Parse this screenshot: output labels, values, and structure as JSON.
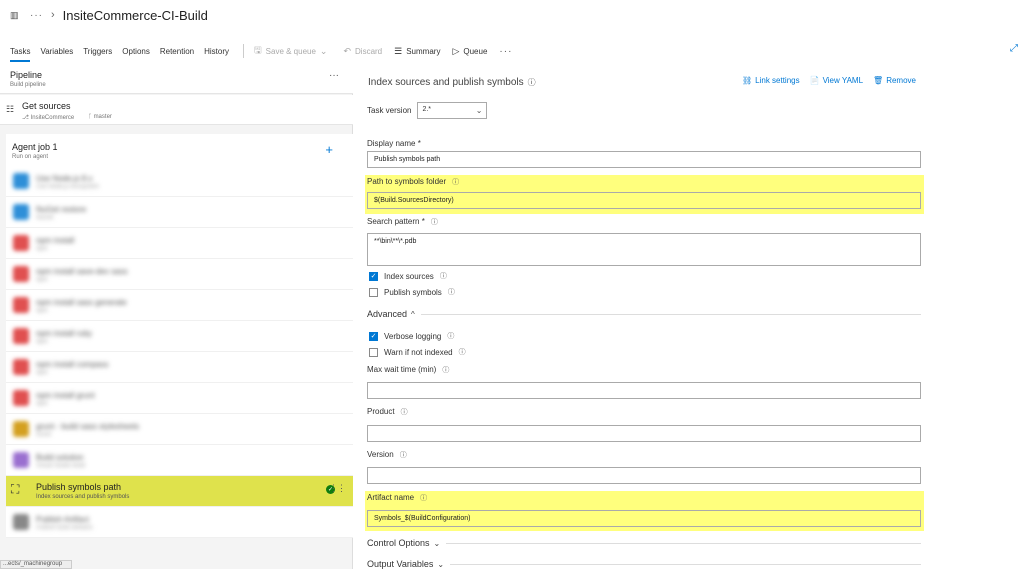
{
  "header": {
    "title": "InsiteCommerce-CI-Build",
    "dots": "···",
    "chevron": "›"
  },
  "tabs": [
    {
      "label": "Tasks",
      "active": true
    },
    {
      "label": "Variables"
    },
    {
      "label": "Triggers"
    },
    {
      "label": "Options"
    },
    {
      "label": "Retention"
    },
    {
      "label": "History"
    }
  ],
  "toolbar": {
    "save_queue": "Save & queue",
    "discard": "Discard",
    "summary": "Summary",
    "queue": "Queue",
    "more": "···"
  },
  "pipeline": {
    "title": "Pipeline",
    "subtitle": "Build pipeline",
    "more": "···"
  },
  "get_sources": {
    "title": "Get sources",
    "repo": "InsiteCommerce",
    "branch": "master"
  },
  "agent_job": {
    "title": "Agent job 1",
    "subtitle": "Run on agent",
    "add": "+"
  },
  "tasks": [
    {
      "title": "Use Node.js 8.x",
      "sub": "Use Node.js ecosystem",
      "color": "#2e8fd8"
    },
    {
      "title": "NuGet restore",
      "sub": "NuGet",
      "color": "#2e8fd8"
    },
    {
      "title": "npm install",
      "sub": "npm",
      "color": "#e05050"
    },
    {
      "title": "npm install save-dev sass",
      "sub": "npm",
      "color": "#e05050"
    },
    {
      "title": "npm install sass generate",
      "sub": "npm",
      "color": "#e05050"
    },
    {
      "title": "npm install ruby",
      "sub": "npm",
      "color": "#e05050"
    },
    {
      "title": "npm install compass",
      "sub": "npm",
      "color": "#e05050"
    },
    {
      "title": "npm install grunt",
      "sub": "npm",
      "color": "#e05050"
    },
    {
      "title": "grunt - build sass stylesheets",
      "sub": "Grunt",
      "color": "#d4a020"
    },
    {
      "title": "Build solution",
      "sub": "Visual Studio build",
      "color": "#9a6fd0"
    }
  ],
  "selected_task": {
    "title": "Publish symbols path",
    "subtitle": "Index sources and publish symbols",
    "status": "✓",
    "grip": "⋮⋮"
  },
  "last_task": {
    "title": "Publish Artifact",
    "sub": "Publish build artifacts"
  },
  "statusbar": "...ects/_machinegroup",
  "panel": {
    "title": "Index sources and publish symbols",
    "link_settings": "Link settings",
    "view_yaml": "View YAML",
    "remove": "Remove",
    "task_version_label": "Task version",
    "task_version": "2.*",
    "display_name_label": "Display name *",
    "display_name": "Publish symbols path",
    "symbols_folder_label": "Path to symbols folder",
    "symbols_folder": "$(Build.SourcesDirectory)",
    "search_pattern_label": "Search pattern *",
    "search_pattern": "**\\bin\\**\\*.pdb",
    "index_sources": "Index sources",
    "publish_symbols": "Publish symbols",
    "advanced": "Advanced",
    "verbose_logging": "Verbose logging",
    "warn_if_not_indexed": "Warn if not indexed",
    "max_wait_label": "Max wait time (min)",
    "product_label": "Product",
    "version_label": "Version",
    "artifact_name_label": "Artifact name",
    "artifact_name": "Symbols_$(BuildConfiguration)",
    "control_options": "Control Options",
    "output_variables": "Output Variables"
  },
  "checkboxes": {
    "index_sources": true,
    "publish_symbols": false,
    "verbose_logging": true,
    "warn_if_not_indexed": false
  },
  "colors": {
    "accent": "#0078d4",
    "highlight": "#ffff66",
    "selected_row": "#dfe24c",
    "success": "#107c10"
  }
}
